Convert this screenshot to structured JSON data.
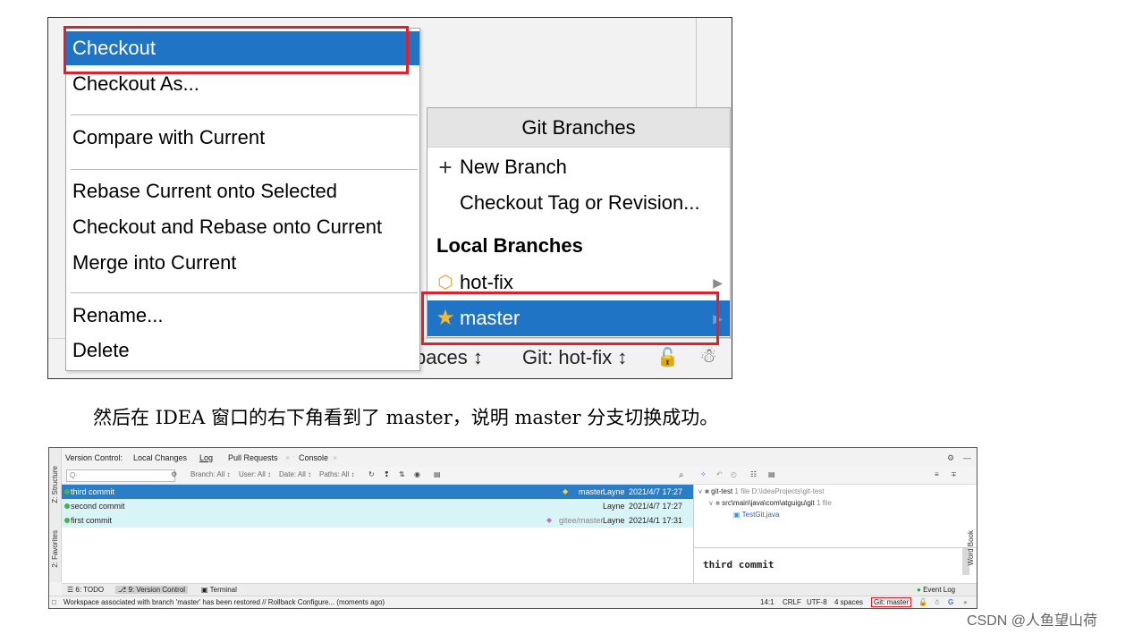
{
  "top_screenshot": {
    "context_menu": {
      "items": [
        {
          "label": "Checkout"
        },
        {
          "label": "Checkout As..."
        },
        {
          "label": "Compare with Current"
        },
        {
          "label": "Rebase Current onto Selected"
        },
        {
          "label": "Checkout and Rebase onto Current"
        },
        {
          "label": "Merge into Current"
        },
        {
          "label": "Rename..."
        },
        {
          "label": "Delete"
        }
      ]
    },
    "git_branches": {
      "title": "Git Branches",
      "new_branch": "New Branch",
      "checkout_tag": "Checkout Tag or Revision...",
      "local_branches_header": "Local Branches",
      "branches": [
        {
          "name": "hot-fix"
        },
        {
          "name": "master"
        }
      ]
    },
    "statusbar": {
      "spaces_text": "paces ↕",
      "git_text": "Git: hot-fix ↕"
    }
  },
  "caption": "然后在 IDEA 窗口的右下角看到了 master，说明 master 分支切换成功。",
  "bottom_screenshot": {
    "left_strip": {
      "structure": "Z: Structure",
      "favorites": "2: Favorites"
    },
    "tabs": [
      "Version Control:",
      "Local Changes",
      "Log",
      "Pull Requests",
      "Console"
    ],
    "toolbar": {
      "search_placeholder": "Q·",
      "branch_filter": "Branch: All ↕",
      "user_filter": "User: All ↕",
      "date_filter": "Date: All ↕",
      "paths_filter": "Paths: All ↕"
    },
    "commits": [
      {
        "message": "third commit",
        "tag": "master",
        "author": "Layne",
        "date": "2021/4/7 17:27"
      },
      {
        "message": "second commit",
        "tag": "",
        "author": "Layne",
        "date": "2021/4/7 17:27"
      },
      {
        "message": "first commit",
        "tag": "gitee/master",
        "author": "Layne",
        "date": "2021/4/1 17:31"
      }
    ],
    "details": {
      "repo": "git-test",
      "repo_info": "1 file  D:\\IdeaProjects\\git-test",
      "path": "src\\main\\java\\com\\atguigu\\git",
      "path_info": "1 file",
      "file": "TestGit.java",
      "commit_message": "third commit"
    },
    "right_strip": "Word Book",
    "bottom_tabs": {
      "todo": "6: TODO",
      "version_control": "9: Version Control",
      "terminal": "Terminal",
      "event_log": "Event Log"
    },
    "status": {
      "message": "Workspace associated with branch 'master' has been restored // Rollback  Configure... (moments ago)",
      "position": "14:1",
      "line_sep": "CRLF",
      "encoding": "UTF-8",
      "indent": "4 spaces",
      "git_branch": "Git: master"
    }
  },
  "watermark": "CSDN @人鱼望山荷",
  "colors": {
    "selection": "#1f74c6",
    "highlight_box": "#e0202a",
    "commit_alt_row": "#d9f4f7"
  }
}
